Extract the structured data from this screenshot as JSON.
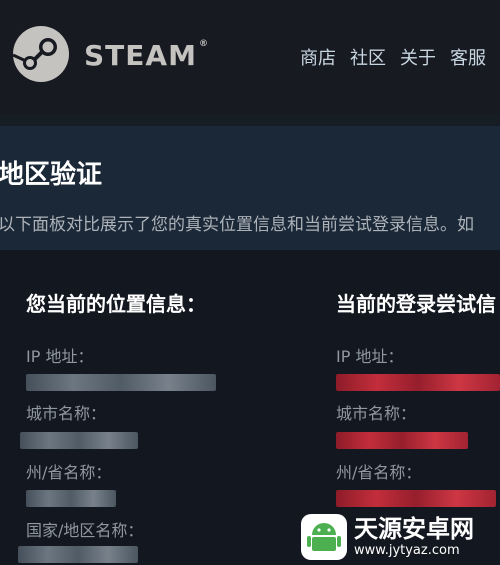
{
  "header": {
    "brand": "STEAM",
    "nav": [
      "商店",
      "社区",
      "关于",
      "客服"
    ]
  },
  "banner": {
    "title": "地区验证",
    "description": "以下面板对比展示了您的真实位置信息和当前尝试登录信息。如"
  },
  "current_location": {
    "title": "您当前的位置信息：",
    "labels": [
      "IP 地址：",
      "城市名称：",
      "州/省名称：",
      "国家/地区名称："
    ]
  },
  "login_attempt": {
    "title": "当前的登录尝试信",
    "labels": [
      "IP 地址：",
      "城市名称：",
      "州/省名称："
    ]
  },
  "watermark": {
    "name": "天源安卓网",
    "url": "www.jytyaz.com"
  },
  "colors": {
    "header_bg": "#171a21",
    "banner_bg": "#1b2838",
    "content_bg": "#13171f",
    "label": "#8f98a0",
    "mismatch_red": "#d6303e",
    "watermark_green": "#4caf50"
  }
}
